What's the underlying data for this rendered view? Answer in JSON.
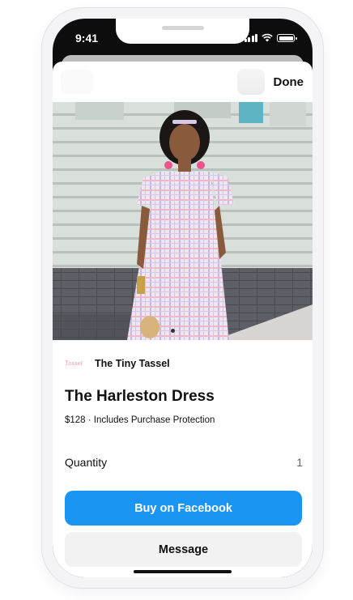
{
  "status_bar": {
    "time": "9:41"
  },
  "header": {
    "done_label": "Done"
  },
  "product": {
    "photo_icon": "product-photo",
    "seller_logo_text": "Tassel",
    "seller_name": "The Tiny Tassel",
    "title": "The Harleston Dress",
    "price_line": "$128 · Includes Purchase Protection"
  },
  "quantity": {
    "label": "Quantity",
    "value": "1"
  },
  "actions": {
    "buy_label": "Buy on Facebook",
    "message_label": "Message"
  },
  "colors": {
    "primary": "#1b95f3",
    "secondary_bg": "#f2f2f2"
  }
}
